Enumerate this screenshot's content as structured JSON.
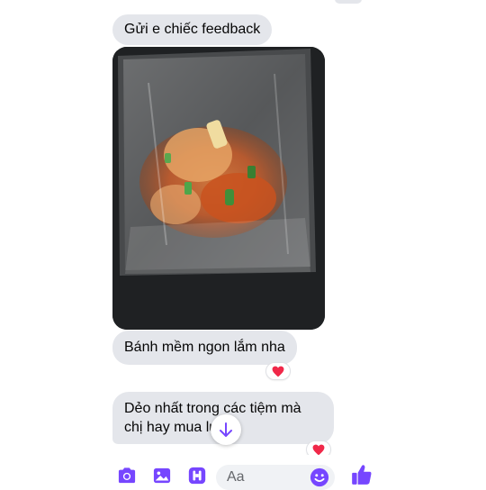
{
  "colors": {
    "accent": "#7646ff",
    "bubble": "#e4e6eb",
    "heart": "#f02849"
  },
  "messages": [
    {
      "text": "Gửi e chiếc feedback"
    },
    {
      "image": "food-bag-photo"
    },
    {
      "text": "Bánh mềm ngon lắm nha",
      "reaction": "❤"
    },
    {
      "text": "Dẻo nhất trong các tiệm mà chị hay mua luôn",
      "reaction": "❤"
    }
  ],
  "composer": {
    "placeholder": "Aa",
    "icons": [
      "camera-icon",
      "gallery-icon",
      "voice-icon",
      "emoji-icon",
      "thumbs-up-icon"
    ]
  },
  "scroll_button": {
    "icon": "arrow-down-icon"
  }
}
